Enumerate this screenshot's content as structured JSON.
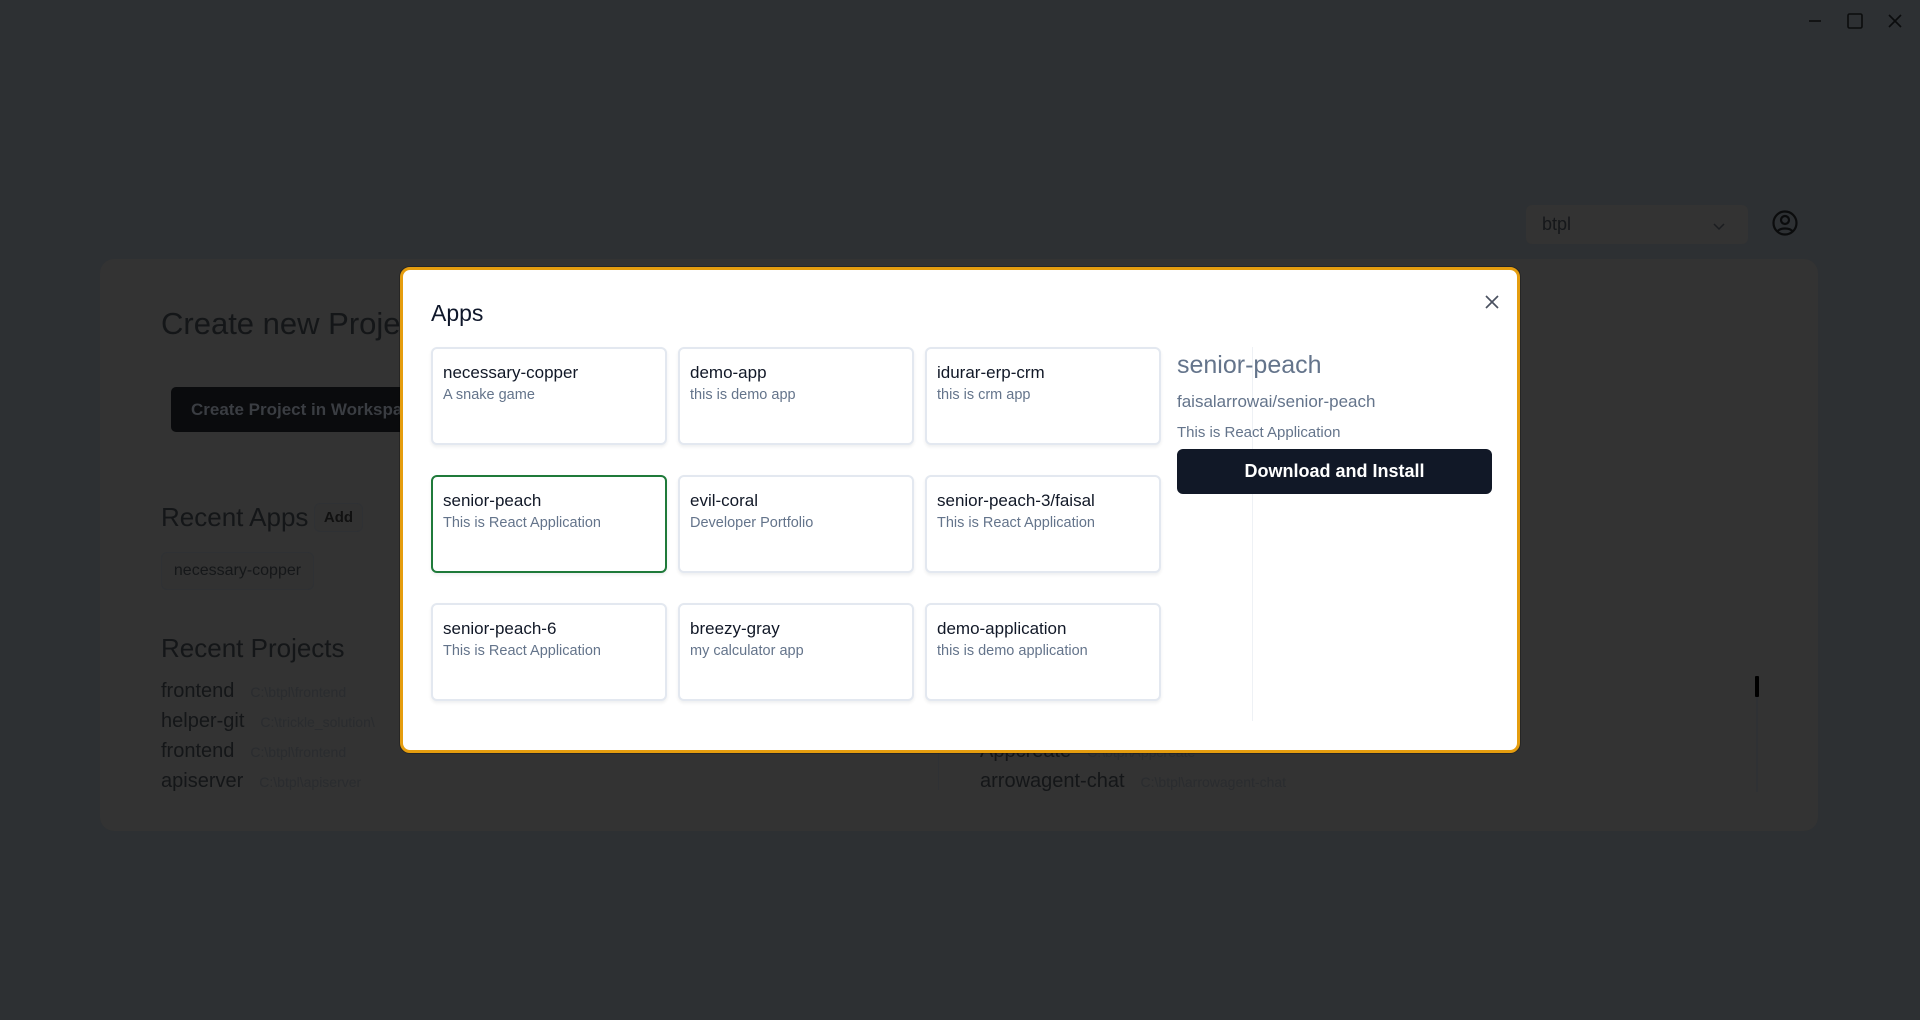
{
  "window_controls": {
    "minimize_icon": "minimize-icon",
    "maximize_icon": "maximize-icon",
    "close_icon": "close-icon"
  },
  "header": {
    "workspace_selected": "btpl",
    "workspace_chevron_icon": "chevron-down-icon",
    "user_icon": "user-circle-icon"
  },
  "background": {
    "create_title": "Create new Project",
    "create_button_label": "Create Project in Workspace",
    "recent_apps_title": "Recent Apps",
    "add_button_label": "Add",
    "recent_apps": [
      "necessary-copper"
    ],
    "recent_projects_title": "Recent Projects",
    "recent_projects_left": [
      {
        "name": "frontend",
        "path": "C:\\btpl\\frontend"
      },
      {
        "name": "helper-git",
        "path": "C:\\trickle_solution\\"
      },
      {
        "name": "frontend",
        "path": "C:\\btpl\\frontend"
      },
      {
        "name": "apiserver",
        "path": "C:\\btpl\\apiserver"
      }
    ],
    "recent_projects_right": [
      {
        "name": "Appcreate",
        "path": "C:\\btpl\\Appcreate"
      },
      {
        "name": "arrowagent-chat",
        "path": "C:\\btpl\\arrowagent-chat"
      }
    ]
  },
  "modal": {
    "title": "Apps",
    "close_icon": "close-icon",
    "accent_border_color": "#e59d0f",
    "selected_border_color": "#1f7a3a",
    "apps": [
      {
        "name": "necessary-copper",
        "description": "A snake game",
        "selected": false
      },
      {
        "name": "demo-app",
        "description": "this is demo app",
        "selected": false
      },
      {
        "name": "idurar-erp-crm",
        "description": "this is crm app",
        "selected": false
      },
      {
        "name": "senior-peach",
        "description": "This is React Application",
        "selected": true
      },
      {
        "name": "evil-coral",
        "description": "Developer Portfolio",
        "selected": false
      },
      {
        "name": "senior-peach-3/faisal",
        "description": "This is React Application",
        "selected": false
      },
      {
        "name": "senior-peach-6",
        "description": "This is React Application",
        "selected": false
      },
      {
        "name": "breezy-gray",
        "description": "my calculator app",
        "selected": false
      },
      {
        "name": "demo-application",
        "description": "this is demo application",
        "selected": false
      }
    ],
    "detail": {
      "name": "senior-peach",
      "repo": "faisalarrowai/senior-peach",
      "description": "This is React Application",
      "action_label": "Download and Install"
    }
  }
}
